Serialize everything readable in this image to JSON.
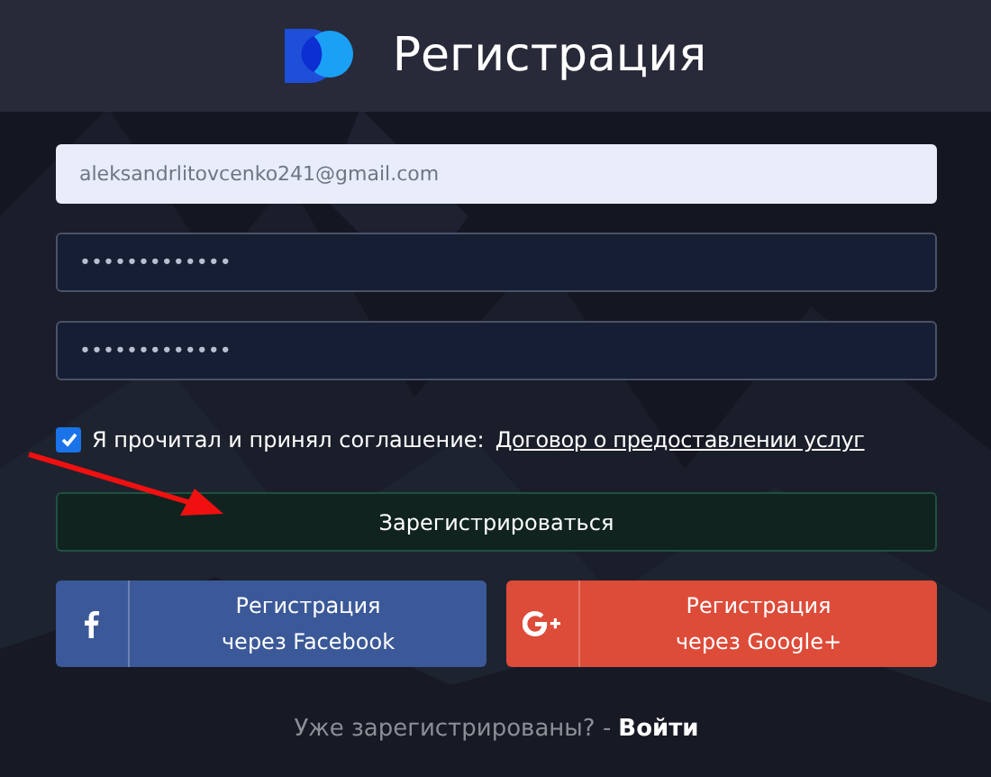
{
  "header": {
    "title": "Регистрация"
  },
  "fields": [
    {
      "kind": "email",
      "value": "aleksandrlitovcenko241@gmail.com"
    },
    {
      "kind": "password",
      "value": "•••••••••••••"
    },
    {
      "kind": "password",
      "value": "•••••••••••••"
    }
  ],
  "agreement": {
    "checked": true,
    "text": "Я прочитал и принял соглашение:",
    "link": "Договор о предоставлении услуг"
  },
  "register_button": "Зарегистрироваться",
  "social_buttons": [
    {
      "kind": "facebook",
      "label": "Регистрация через Facebook",
      "color": "#3b5998"
    },
    {
      "kind": "google",
      "label": "Регистрация через Google+",
      "color": "#dd4b39"
    }
  ],
  "footer": {
    "text": "Уже зарегистрированы? -",
    "link": "Войти"
  }
}
